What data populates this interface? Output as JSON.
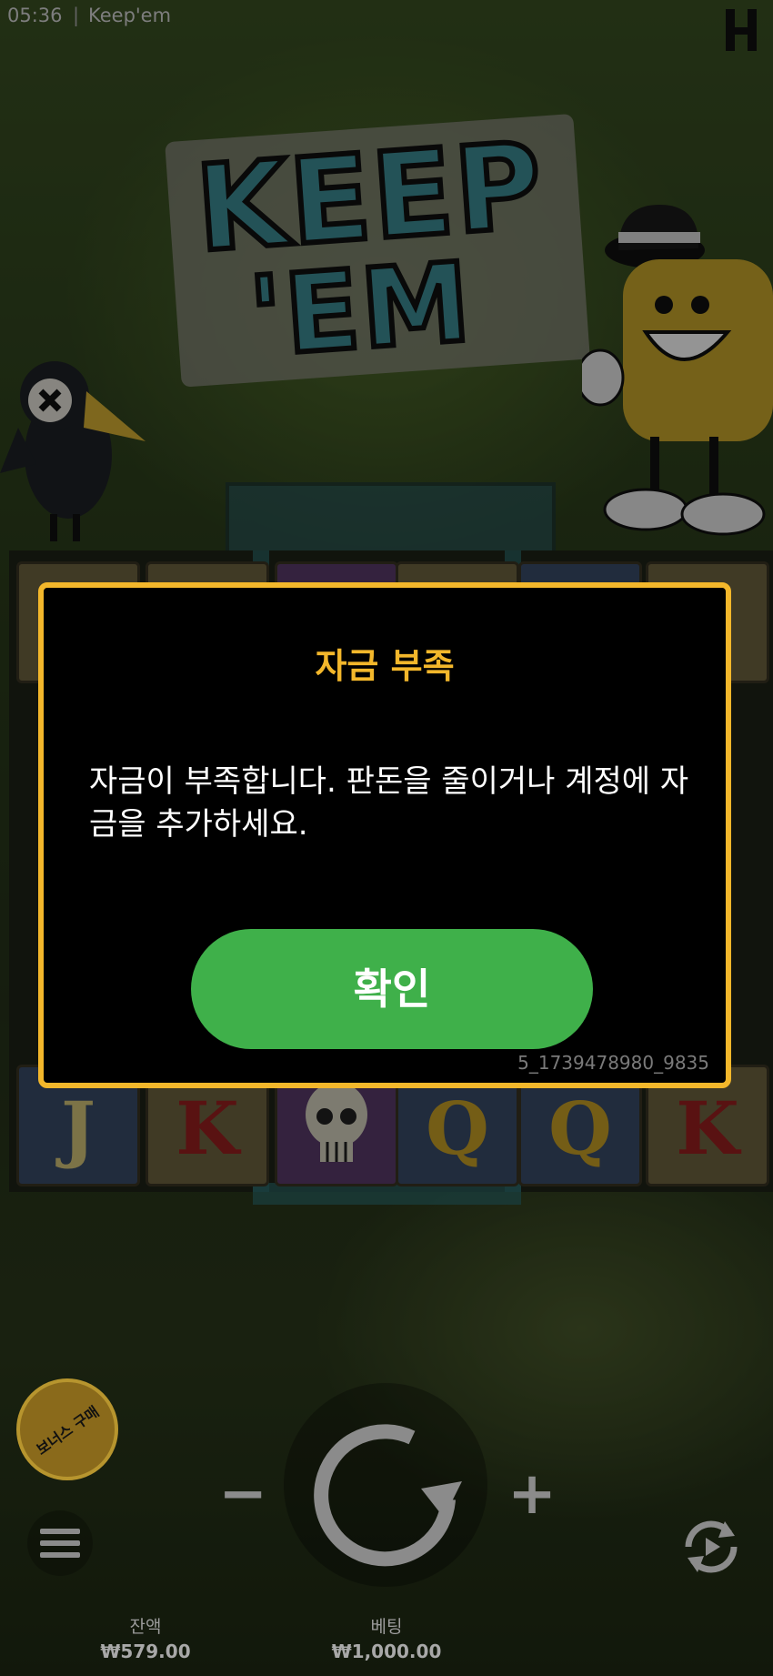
{
  "status_bar": {
    "time": "05:36",
    "separator": "|",
    "game_title": "Keep'em"
  },
  "logo": {
    "line1": "KEEP",
    "line2": "'EM"
  },
  "reels": {
    "symbols": [
      [
        "",
        "",
        "",
        "",
        "",
        ""
      ],
      [
        "J",
        "K",
        "skull",
        "Q",
        "Q",
        "K"
      ]
    ]
  },
  "dialog": {
    "title": "자금 부족",
    "message": "자금이 부족합니다. 판돈을 줄이거나 계정에 자금을 추가하세요.",
    "confirm_label": "확인",
    "session_id": "5_1739478980_9835"
  },
  "controls": {
    "bonus_buy_label": "보너스 구매",
    "minus_label": "−",
    "plus_label": "+",
    "balance_label": "잔액",
    "balance_value": "₩579.00",
    "bet_label": "베팅",
    "bet_value": "₩1,000.00"
  },
  "colors": {
    "dialog_border": "#f3b72b",
    "title": "#f3b72b",
    "confirm_button": "#3fb04a"
  }
}
